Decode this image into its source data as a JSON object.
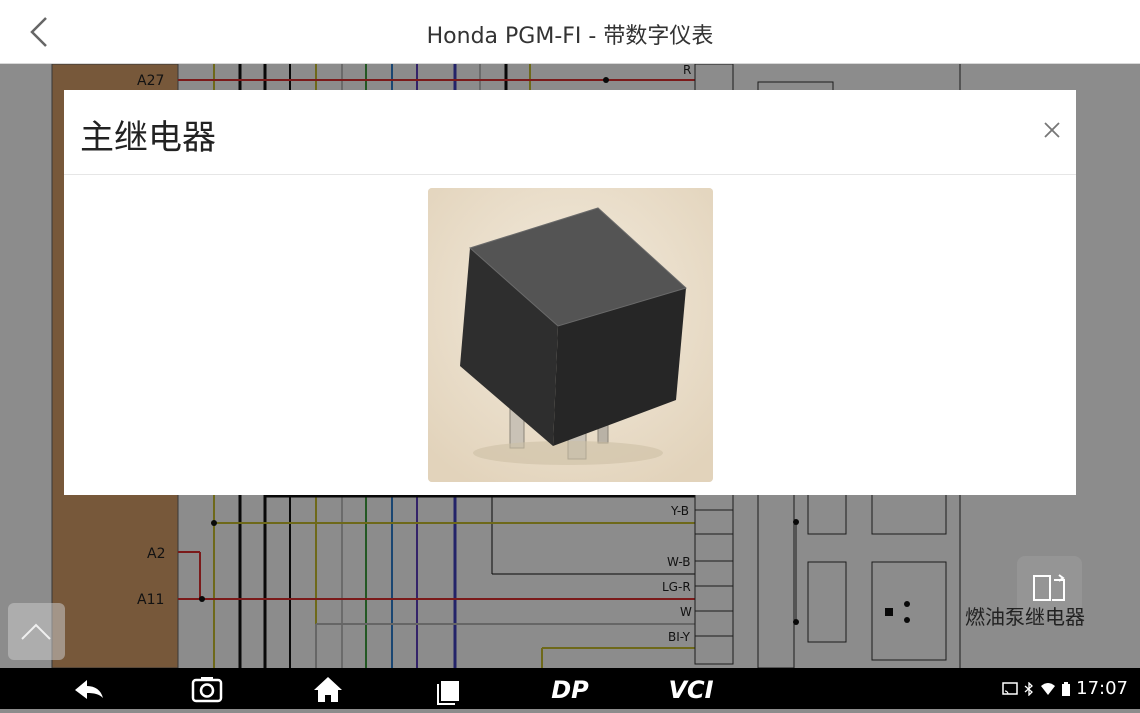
{
  "header": {
    "title": "Honda PGM-FI - 带数字仪表"
  },
  "diagram": {
    "pin_labels": [
      "A27",
      "A2",
      "A11"
    ],
    "wire_labels": [
      "R",
      "Y-B",
      "W-B",
      "LG-R",
      "W",
      "BI-Y"
    ],
    "fuel_pump_relay_label": "燃油泵继电器",
    "colors": {
      "ecu_block": "#d9a06a",
      "red_wire": "#e03030",
      "yellow_wire": "#c8c030",
      "green_wire": "#40a040",
      "blue_wire": "#3080d0",
      "purple_wire": "#6040c0"
    }
  },
  "modal": {
    "title": "主继电器",
    "close_icon": "close-icon",
    "image_alt": "主继电器"
  },
  "navbar": {
    "icons": [
      "back-arrow-icon",
      "camera-icon",
      "home-icon",
      "recent-apps-icon",
      "dp-icon",
      "vci-icon"
    ],
    "dp_label": "DP",
    "vci_label": "VCI",
    "time": "17:07"
  }
}
